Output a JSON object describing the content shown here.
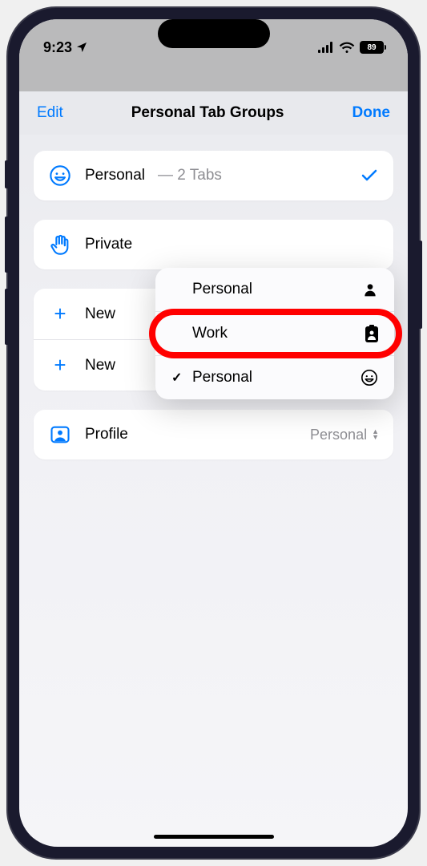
{
  "status": {
    "time": "9:23",
    "battery": "89"
  },
  "nav": {
    "left": "Edit",
    "title": "Personal Tab Groups",
    "right": "Done"
  },
  "tabs": {
    "personal": {
      "label": "Personal",
      "meta": "— 2 Tabs"
    },
    "private": {
      "label": "Private"
    }
  },
  "actions": {
    "new1": "New",
    "new2": "New"
  },
  "profile": {
    "label": "Profile",
    "value": "Personal"
  },
  "popup": {
    "items": [
      {
        "label": "Personal",
        "icon": "person",
        "checked": false
      },
      {
        "label": "Work",
        "icon": "badge",
        "checked": false
      },
      {
        "label": "Personal",
        "icon": "smiley",
        "checked": true
      }
    ]
  }
}
